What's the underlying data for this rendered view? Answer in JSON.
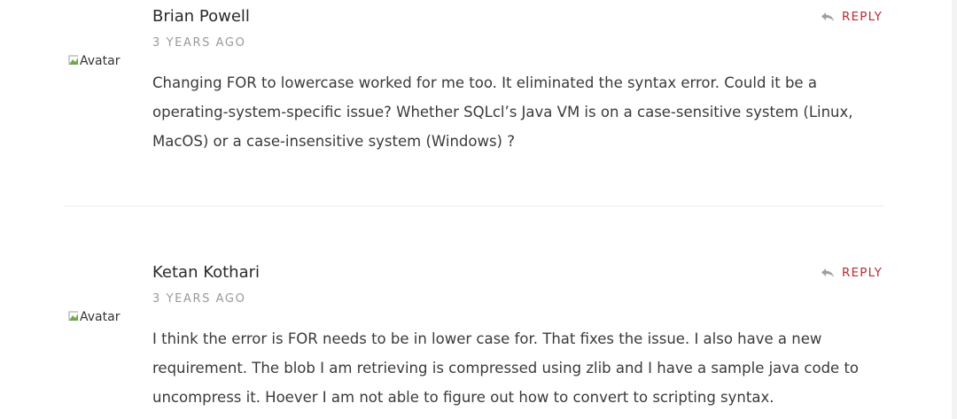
{
  "comments": [
    {
      "author": "Brian Powell",
      "date": "3 YEARS AGO",
      "avatar_alt": "Avatar",
      "reply_label": "REPLY",
      "text": "Changing FOR to lowercase worked for me too. It eliminated the syntax error. Could it be a operating-system-specific issue? Whether SQLcl’s Java VM is on a case-sensitive system (Linux, MacOS) or a case-insensitive system (Windows) ?"
    },
    {
      "author": "Ketan Kothari",
      "date": "3 YEARS AGO",
      "avatar_alt": "Avatar",
      "reply_label": "REPLY",
      "text": "I think the error is FOR needs to be in lower case for. That fixes the issue. I also have a new requirement. The blob I am retrieving is compressed using zlib and I have a sample java code to uncompress it. Hoever I am not able to figure out how to convert to scripting syntax."
    }
  ],
  "colors": {
    "reply_accent": "#c0292f",
    "date_gray": "#9a9a9a",
    "divider": "#ececec"
  },
  "icons": {
    "reply": "reply-arrow-icon",
    "avatar": "broken-image-icon"
  }
}
